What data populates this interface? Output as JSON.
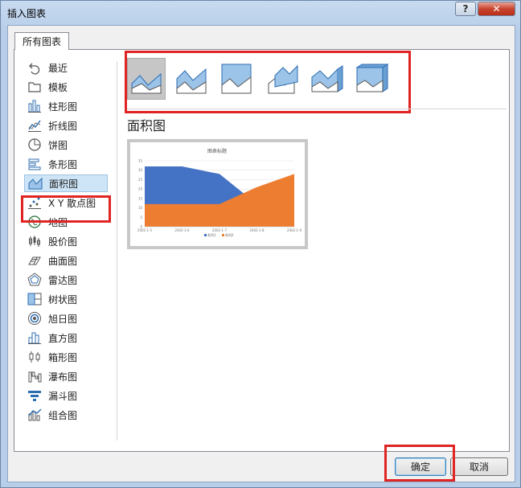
{
  "window": {
    "title": "插入图表",
    "help_label": "?",
    "close_label": "✕"
  },
  "tab": {
    "label": "所有图表"
  },
  "sidebar": {
    "items": [
      {
        "label": "最近",
        "icon": "recent-icon"
      },
      {
        "label": "模板",
        "icon": "folder-icon"
      },
      {
        "label": "柱形图",
        "icon": "column-chart-icon"
      },
      {
        "label": "折线图",
        "icon": "line-chart-icon"
      },
      {
        "label": "饼图",
        "icon": "pie-chart-icon"
      },
      {
        "label": "条形图",
        "icon": "bar-chart-icon"
      },
      {
        "label": "面积图",
        "icon": "area-chart-icon",
        "selected": true
      },
      {
        "label": "X Y 散点图",
        "icon": "scatter-chart-icon"
      },
      {
        "label": "地图",
        "icon": "map-chart-icon"
      },
      {
        "label": "股价图",
        "icon": "stock-chart-icon"
      },
      {
        "label": "曲面图",
        "icon": "surface-chart-icon"
      },
      {
        "label": "雷达图",
        "icon": "radar-chart-icon"
      },
      {
        "label": "树状图",
        "icon": "treemap-chart-icon"
      },
      {
        "label": "旭日图",
        "icon": "sunburst-chart-icon"
      },
      {
        "label": "直方图",
        "icon": "histogram-chart-icon"
      },
      {
        "label": "箱形图",
        "icon": "box-whisker-chart-icon"
      },
      {
        "label": "瀑布图",
        "icon": "waterfall-chart-icon"
      },
      {
        "label": "漏斗图",
        "icon": "funnel-chart-icon"
      },
      {
        "label": "组合图",
        "icon": "combo-chart-icon"
      }
    ]
  },
  "subtypes": [
    {
      "name": "area-subtype",
      "selected": true
    },
    {
      "name": "stacked-area-subtype"
    },
    {
      "name": "percent-stacked-area-subtype"
    },
    {
      "name": "3d-area-subtype"
    },
    {
      "name": "3d-stacked-area-subtype"
    },
    {
      "name": "3d-percent-stacked-area-subtype"
    }
  ],
  "main": {
    "heading": "面积图"
  },
  "preview": {
    "title": "图表标题",
    "legend": [
      "系列1",
      "系列2"
    ]
  },
  "chart_data": {
    "type": "area",
    "title": "图表标题",
    "categories": [
      "2002-1-5",
      "2002-1-6",
      "2002-1-7",
      "2002-1-8",
      "2002-1-9"
    ],
    "series": [
      {
        "name": "系列1",
        "values": [
          32,
          32,
          28,
          12,
          15
        ],
        "color": "#4472c4"
      },
      {
        "name": "系列2",
        "values": [
          12,
          12,
          12,
          21,
          28
        ],
        "color": "#ed7d31"
      }
    ],
    "ylim": [
      0,
      35
    ],
    "yticks": [
      0,
      5,
      10,
      15,
      20,
      25,
      30,
      35
    ],
    "grid": true,
    "legend": "bottom"
  },
  "buttons": {
    "ok": "确定",
    "cancel": "取消"
  },
  "colors": {
    "highlight": "#e02424",
    "accent_blue": "#4472c4",
    "accent_orange": "#ed7d31"
  }
}
